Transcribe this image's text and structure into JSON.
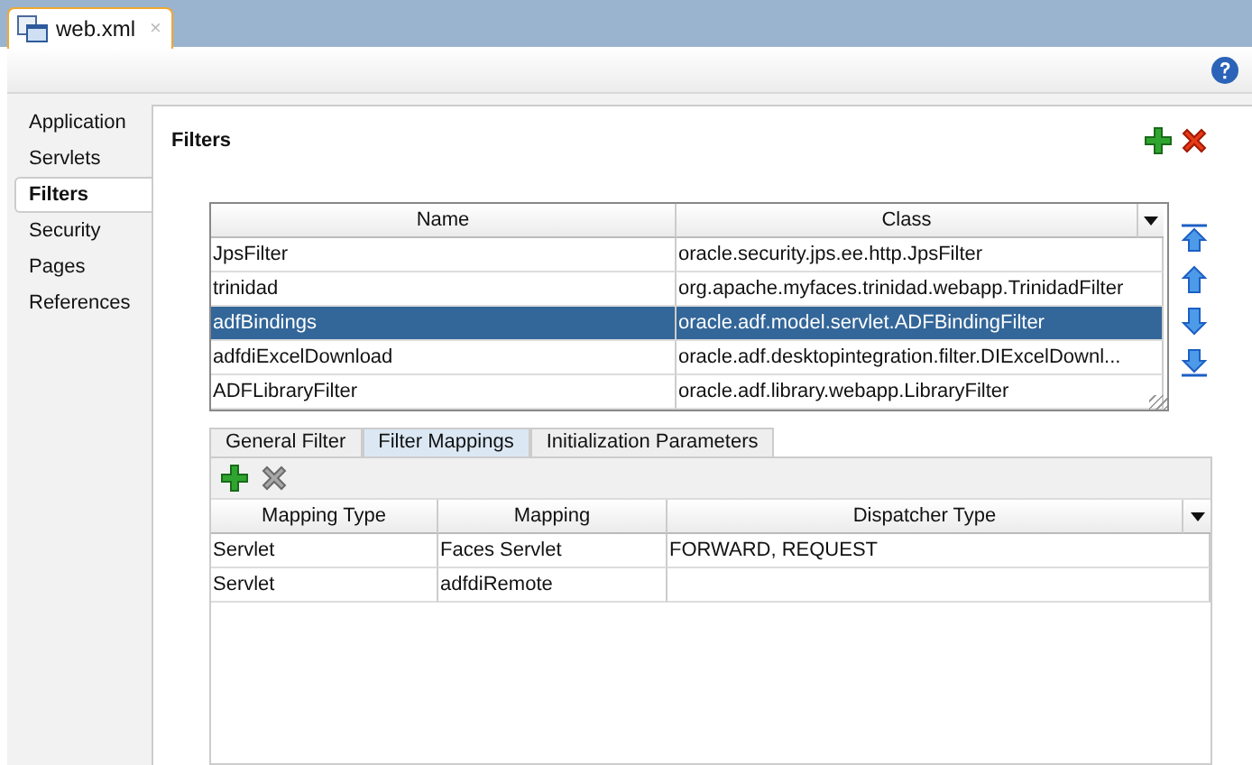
{
  "editor_tab": {
    "title": "web.xml",
    "close_glyph": "×"
  },
  "sidebar": {
    "items": [
      {
        "label": "Application",
        "selected": false
      },
      {
        "label": "Servlets",
        "selected": false
      },
      {
        "label": "Filters",
        "selected": true
      },
      {
        "label": "Security",
        "selected": false
      },
      {
        "label": "Pages",
        "selected": false
      },
      {
        "label": "References",
        "selected": false
      }
    ]
  },
  "section": {
    "title": "Filters",
    "actions": [
      {
        "kind": "add",
        "disabled": false
      },
      {
        "kind": "delete",
        "disabled": false
      }
    ]
  },
  "filters_table": {
    "columns": [
      "Name",
      "Class"
    ],
    "rows": [
      {
        "name": "JpsFilter",
        "class": "oracle.security.jps.ee.http.JpsFilter",
        "selected": false
      },
      {
        "name": "trinidad",
        "class": "org.apache.myfaces.trinidad.webapp.TrinidadFilter",
        "selected": false
      },
      {
        "name": "adfBindings",
        "class": "oracle.adf.model.servlet.ADFBindingFilter",
        "selected": true
      },
      {
        "name": "adfdiExcelDownload",
        "class": "oracle.adf.desktopintegration.filter.DIExcelDownl...",
        "selected": false
      },
      {
        "name": "ADFLibraryFilter",
        "class": "oracle.adf.library.webapp.LibraryFilter",
        "selected": false
      }
    ],
    "move_buttons": [
      {
        "kind": "top"
      },
      {
        "kind": "up"
      },
      {
        "kind": "down"
      },
      {
        "kind": "bottom"
      }
    ]
  },
  "detail_tabs": [
    {
      "label": "General Filter",
      "selected": false
    },
    {
      "label": "Filter Mappings",
      "selected": true
    },
    {
      "label": "Initialization Parameters",
      "selected": false
    }
  ],
  "mappings": {
    "actions": [
      {
        "kind": "add",
        "disabled": false
      },
      {
        "kind": "delete",
        "disabled": true
      }
    ],
    "columns": [
      "Mapping Type",
      "Mapping",
      "Dispatcher Type"
    ],
    "rows": [
      {
        "cells": [
          "Servlet",
          "Faces Servlet",
          "FORWARD, REQUEST"
        ]
      },
      {
        "cells": [
          "Servlet",
          "adfdiRemote"
        ]
      }
    ]
  }
}
